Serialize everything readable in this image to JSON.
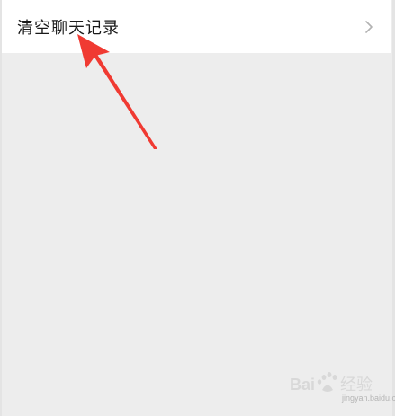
{
  "settings": {
    "clear_chat_label": "清空聊天记录"
  },
  "icons": {
    "row_chevron": "chevron-right-icon"
  },
  "annotation": {
    "arrow_color": "#f03a32"
  },
  "watermark": {
    "brand": "Bai百度",
    "caption": "jingyan.baidu.com"
  },
  "colors": {
    "background": "#ededed",
    "row_background": "#ffffff",
    "label": "#1a1a1a",
    "chevron": "#b2b2b2"
  }
}
